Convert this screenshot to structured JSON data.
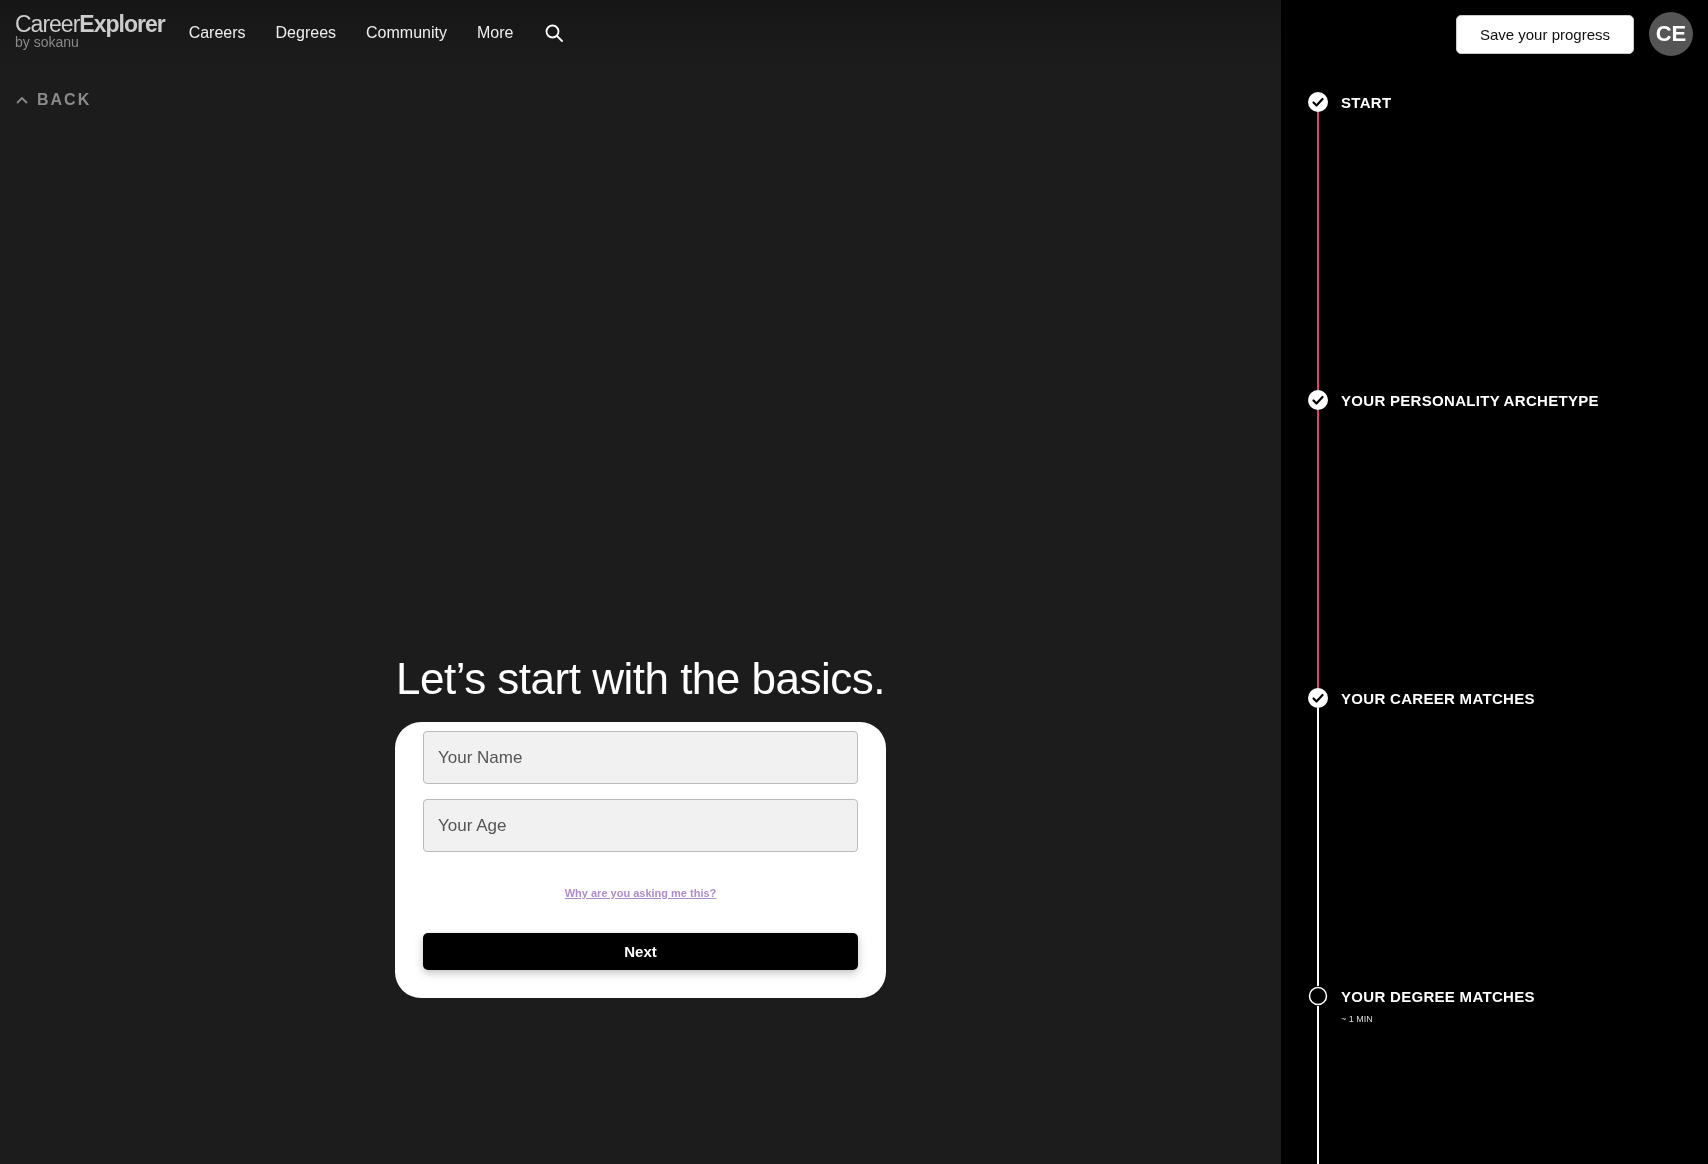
{
  "header": {
    "logo": "Career**Explorer**",
    "byline": "by sokanu",
    "nav": [
      "Careers",
      "Degrees",
      "Community",
      "More"
    ]
  },
  "back": {
    "label": "BACK"
  },
  "heading": "Let’s start with the basics.",
  "form": {
    "fields": [
      {
        "placeholder": "Your Name"
      },
      {
        "placeholder": "Your Age"
      }
    ],
    "help_link": "Why are you asking me this?",
    "submit": "Next"
  },
  "save_button": "Save your progress",
  "avatar": "CE",
  "steps": [
    {
      "label": "START",
      "completed": true
    },
    {
      "label": "YOUR PERSONALITY ARCHETYPE",
      "completed": true
    },
    {
      "label": "YOUR CAREER MATCHES",
      "completed": true
    },
    {
      "label": "YOUR DEGREE MATCHES",
      "completed": false,
      "duration": "~ 1 MIN"
    }
  ]
}
